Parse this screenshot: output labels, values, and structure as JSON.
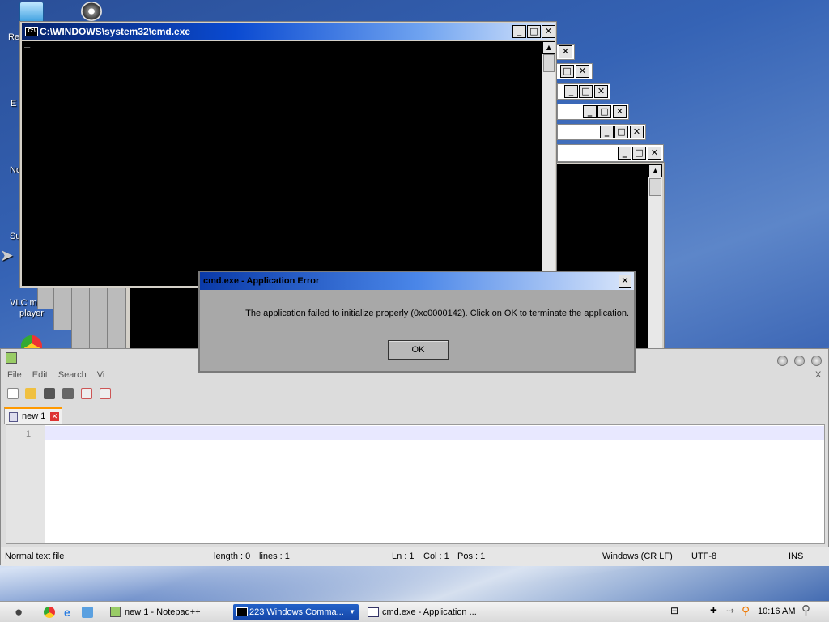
{
  "desktop": {
    "icons": [
      {
        "label": "Re",
        "icon": "recycle-bin-icon"
      },
      {
        "label": "E",
        "icon": "desktop-shortcut-icon"
      },
      {
        "label": "No",
        "icon": "desktop-shortcut-icon"
      },
      {
        "label": "Su",
        "icon": "desktop-shortcut-icon"
      },
      {
        "label": "VLC m",
        "label2": "player",
        "icon": "vlc-icon"
      }
    ],
    "film_icon": "film-reel-icon",
    "chrome_icon": "chrome-icon"
  },
  "cmd_window": {
    "title": "C:\\WINDOWS\\system32\\cmd.exe",
    "cursor": "_",
    "icon_text": "C:\\"
  },
  "dialog": {
    "title": "cmd.exe - Application Error",
    "message": "The application failed to initialize properly (0xc0000142). Click on OK to terminate the application.",
    "ok_label": "OK",
    "close_glyph": "✕"
  },
  "notepad": {
    "menu": [
      "File",
      "Edit",
      "Search",
      "Vi"
    ],
    "tab_label": "new 1",
    "line_number": "1",
    "close_x": "X",
    "status": {
      "type": "Normal text file",
      "length": "length : 0",
      "lines": "lines : 1",
      "ln": "Ln : 1",
      "col": "Col : 1",
      "pos": "Pos : 1",
      "eol": "Windows (CR LF)",
      "encoding": "UTF-8",
      "mode": "INS"
    }
  },
  "taskbar": {
    "tasks": [
      {
        "label": "new 1 - Notepad++",
        "icon": "notepad-plus-icon"
      },
      {
        "label": "223 Windows Comma...",
        "icon": "cmd-icon",
        "active": true
      },
      {
        "label": "cmd.exe - Application ...",
        "icon": "window-icon"
      }
    ],
    "clock": "10:16 AM"
  },
  "colors": {
    "titlebar": "#0a4ad1",
    "console": "#000000",
    "dialog": "#a8a8a8"
  }
}
